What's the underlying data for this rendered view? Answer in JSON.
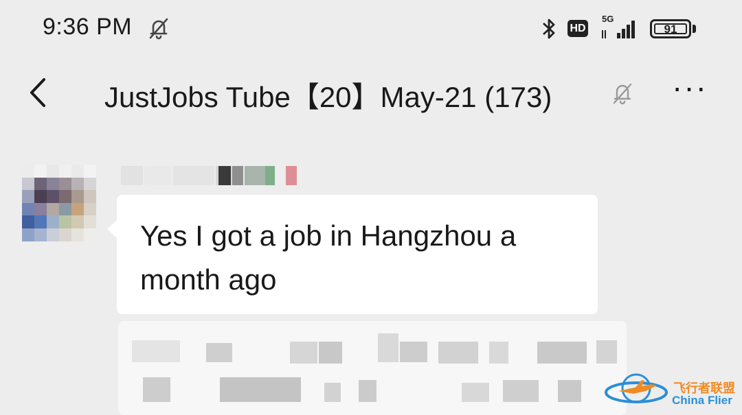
{
  "status_bar": {
    "time": "9:36 PM",
    "notification_icon": "bell-off-icon",
    "bluetooth_icon": "bluetooth-icon",
    "hd_label": "HD",
    "network_label": "5G",
    "signal_icon": "signal-bars-icon",
    "battery_level": "91"
  },
  "header": {
    "back_icon": "chevron-left-icon",
    "title": "JustJobs Tube【20】May-21 (173)",
    "mute_icon": "bell-off-icon",
    "more_label": "···"
  },
  "messages": [
    {
      "sender_name": "",
      "text": "Yes I got a job in Hangzhou a month ago",
      "avatar": "blurred-avatar"
    }
  ],
  "watermark": {
    "cn": "飞行者联盟",
    "en": "China Flier"
  },
  "colors": {
    "background": "#ededed",
    "bubble": "#ffffff",
    "text": "#191919"
  }
}
